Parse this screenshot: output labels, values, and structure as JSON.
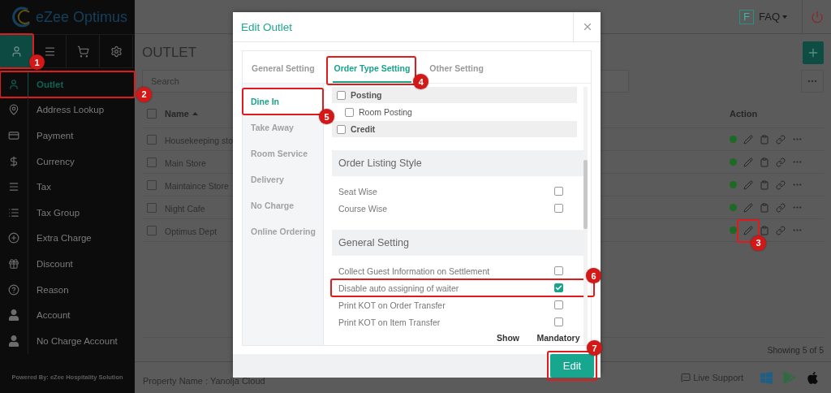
{
  "app": {
    "logo": "eZee Optimus",
    "powered_by": "Powered By: eZee Hospitality Solution"
  },
  "sidebar": {
    "tabs": [
      {
        "selected": true,
        "callout": "1"
      },
      {
        "selected": false
      },
      {
        "selected": false
      },
      {
        "selected": false
      }
    ],
    "items": [
      {
        "label": "Outlet",
        "selected": true,
        "callout": "2"
      },
      {
        "label": "Address Lookup",
        "selected": false
      },
      {
        "label": "Payment",
        "selected": false
      },
      {
        "label": "Currency",
        "selected": false
      },
      {
        "label": "Tax",
        "selected": false
      },
      {
        "label": "Tax Group",
        "selected": false
      },
      {
        "label": "Extra Charge",
        "selected": false
      },
      {
        "label": "Discount",
        "selected": false
      },
      {
        "label": "Reason",
        "selected": false
      },
      {
        "label": "Account",
        "selected": false
      },
      {
        "label": "No Charge Account",
        "selected": false
      }
    ]
  },
  "topbar": {
    "faq_letter": "F",
    "faq": "FAQ"
  },
  "page": {
    "title": "OUTLET",
    "search": {
      "placeholder": "Search"
    },
    "select_all_checked": false,
    "columns": [
      {
        "label": "Name"
      },
      {
        "label": "Action"
      }
    ],
    "rows": [
      {
        "name": "Housekeeping sto",
        "checked": false,
        "active": true
      },
      {
        "name": "Main Store",
        "checked": false,
        "active": true
      },
      {
        "name": "Maintaince Store",
        "checked": false,
        "active": true
      },
      {
        "name": "Night Cafe",
        "checked": false,
        "active": true
      },
      {
        "name": "Optimus Dept",
        "checked": false,
        "active": true,
        "callout": "3"
      }
    ],
    "showing": "Showing 5 of 5"
  },
  "footer": {
    "property": "Property Name : Yanolja Cloud",
    "live_support": "Live Support"
  },
  "modal": {
    "title": "Edit Outlet",
    "tabs": [
      {
        "label": "General Setting",
        "selected": false
      },
      {
        "label": "Order Type Setting",
        "selected": true,
        "callout": "4"
      },
      {
        "label": "Other Setting",
        "selected": false
      }
    ],
    "order_types": [
      {
        "label": "Dine In",
        "selected": true,
        "callout": "5"
      },
      {
        "label": "Take Away",
        "selected": false
      },
      {
        "label": "Room Service",
        "selected": false
      },
      {
        "label": "Delivery",
        "selected": false
      },
      {
        "label": "No Charge",
        "selected": false
      },
      {
        "label": "Online Ordering",
        "selected": false
      }
    ],
    "settings": [
      {
        "kind": "group",
        "label": "Posting",
        "checked": false
      },
      {
        "kind": "subitem",
        "label": "Room Posting",
        "checked": false
      },
      {
        "kind": "group",
        "label": "Credit",
        "checked": false
      },
      {
        "kind": "section",
        "label": "Order Listing Style"
      },
      {
        "kind": "option",
        "label": "Seat Wise",
        "checked": false
      },
      {
        "kind": "option",
        "label": "Course Wise",
        "checked": false
      },
      {
        "kind": "section",
        "label": "General Setting"
      },
      {
        "kind": "option",
        "label": "Collect Guest Information on Settlement",
        "checked": false
      },
      {
        "kind": "option",
        "label": "Disable auto assigning of waiter",
        "checked": true,
        "callout": "6"
      },
      {
        "kind": "option",
        "label": "Print KOT on Order Transfer",
        "checked": false
      },
      {
        "kind": "option",
        "label": "Print KOT on Item Transfer",
        "checked": false
      }
    ],
    "legend": [
      "Show",
      "Mandatory"
    ],
    "submit": {
      "label": "Edit",
      "callout": "7"
    }
  }
}
